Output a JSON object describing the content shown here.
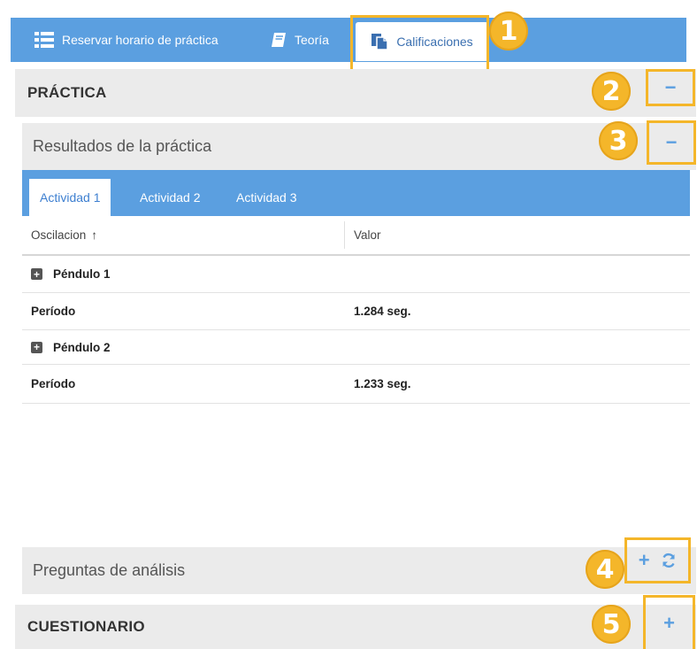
{
  "nav": {
    "reservar_label": "Reservar horario de práctica",
    "teoria_label": "Teoría",
    "calificaciones_label": "Calificaciones"
  },
  "practica": {
    "title": "PRÁCTICA",
    "collapse_symbol": "−"
  },
  "resultados": {
    "title": "Resultados de la práctica",
    "collapse_symbol": "−",
    "tabs": [
      {
        "label": "Actividad 1"
      },
      {
        "label": "Actividad 2"
      },
      {
        "label": "Actividad 3"
      }
    ],
    "table": {
      "columns": [
        "Oscilacion",
        "Valor"
      ],
      "sort_arrow": "↑",
      "rows": [
        {
          "group": "Péndulo 1",
          "label": "Período",
          "value": "1.284 seg."
        },
        {
          "group": "Péndulo 2",
          "label": "Período",
          "value": "1.233 seg."
        }
      ]
    }
  },
  "preguntas": {
    "title": "Preguntas de análisis",
    "expand_symbol": "+"
  },
  "cuestionario": {
    "title": "CUESTIONARIO",
    "expand_symbol": "+"
  },
  "callouts": [
    "1",
    "2",
    "3",
    "4",
    "5"
  ],
  "colors": {
    "nav_blue": "#5b9fe0",
    "callout_orange": "#f4b62a",
    "header_gray": "#ebebeb"
  }
}
